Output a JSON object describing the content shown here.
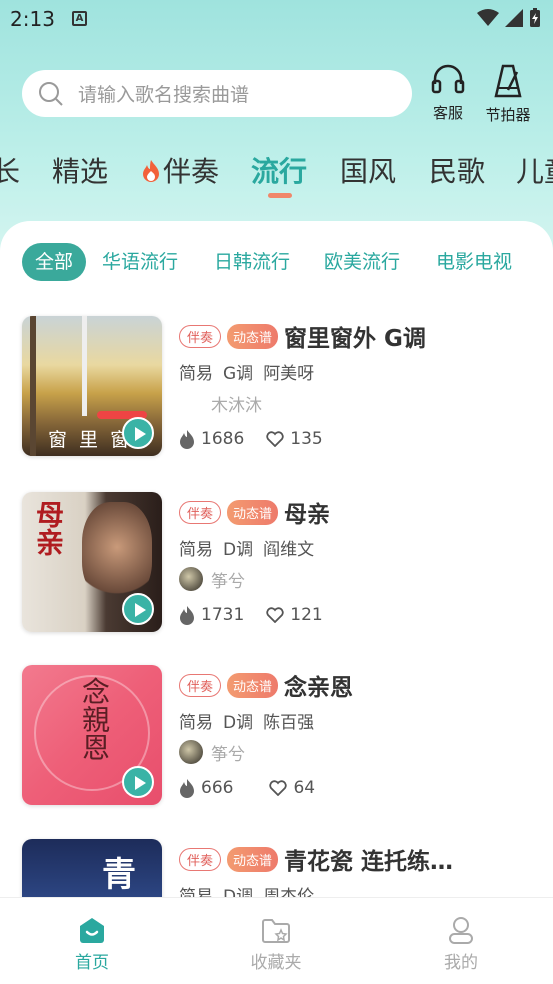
{
  "status_bar": {
    "time": "2:13",
    "badge": "A"
  },
  "search": {
    "placeholder": "请输入歌名搜索曲谱"
  },
  "tools": {
    "kefu": "客服",
    "metronome": "节拍器"
  },
  "categories": [
    {
      "label": "长"
    },
    {
      "label": "精选"
    },
    {
      "label": "伴奏"
    },
    {
      "label": "流行"
    },
    {
      "label": "国风"
    },
    {
      "label": "民歌"
    },
    {
      "label": "儿童"
    }
  ],
  "active_category": "流行",
  "subtabs": [
    {
      "label": "全部"
    },
    {
      "label": "华语流行"
    },
    {
      "label": "日韩流行"
    },
    {
      "label": "欧美流行"
    },
    {
      "label": "电影电视"
    }
  ],
  "songs": [
    {
      "tag1": "伴奏",
      "tag2": "动态谱",
      "title": "窗里窗外 G调",
      "level": "简易",
      "key": "G调",
      "artist": "阿美呀",
      "uploader": "木沐沐",
      "plays": "1686",
      "likes": "135",
      "cover_text": "窗 里 窗"
    },
    {
      "tag1": "伴奏",
      "tag2": "动态谱",
      "title": "母亲",
      "level": "简易",
      "key": "D调",
      "artist": "阎维文",
      "uploader": "筝兮",
      "plays": "1731",
      "likes": "121",
      "cover_text": "母亲"
    },
    {
      "tag1": "伴奏",
      "tag2": "动态谱",
      "title": "念亲恩",
      "level": "简易",
      "key": "D调",
      "artist": "陈百强",
      "uploader": "筝兮",
      "plays": "666",
      "likes": "64",
      "cover_text": "念親恩"
    },
    {
      "tag1": "伴奏",
      "tag2": "动态谱",
      "title": "青花瓷 连托练…",
      "level": "简易",
      "key": "D调",
      "artist": "周杰伦",
      "uploader": "",
      "plays": "",
      "likes": "",
      "cover_text": "青"
    }
  ],
  "bottom_nav": {
    "home": "首页",
    "favorites": "收藏夹",
    "mine": "我的"
  },
  "colors": {
    "accent": "#2aa89f",
    "tag_red": "#e0605b",
    "underline": "#f0876a"
  }
}
